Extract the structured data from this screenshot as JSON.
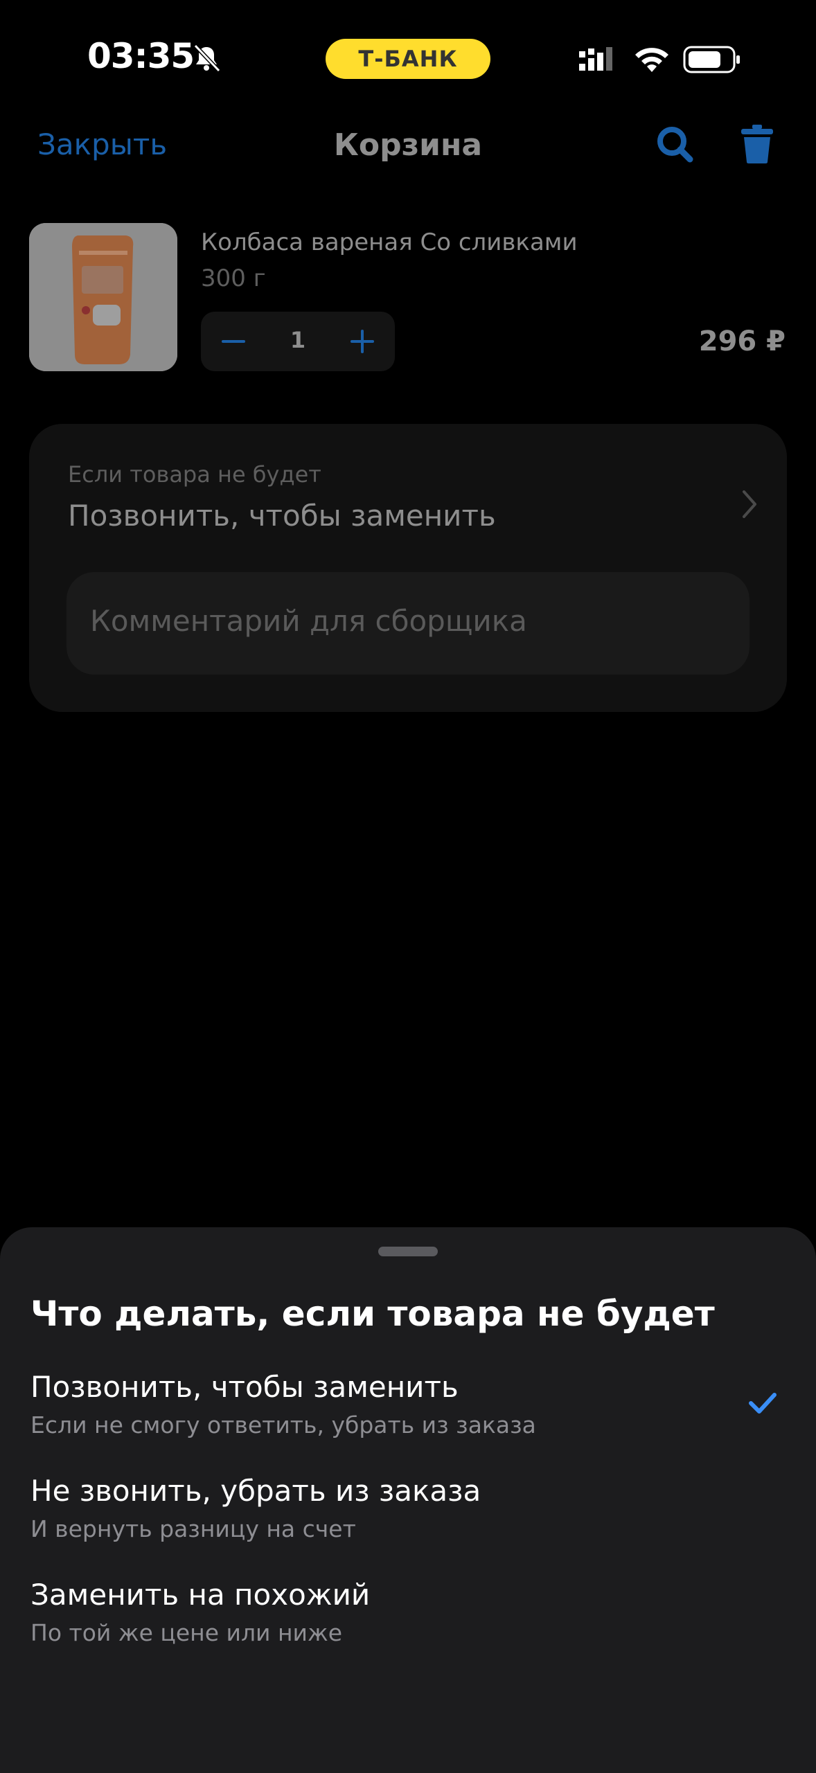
{
  "status_bar": {
    "time": "03:35",
    "bank_badge": "Т-БАНК"
  },
  "nav": {
    "close_label": "Закрыть",
    "title": "Корзина"
  },
  "product": {
    "name": "Колбаса вареная Со сливками",
    "weight": "300 г",
    "quantity": "1",
    "price": "296 ₽"
  },
  "replacement_card": {
    "caption": "Если товара не будет",
    "value": "Позвонить, чтобы заменить",
    "comment_placeholder": "Комментарий для сборщика"
  },
  "sheet": {
    "title": "Что делать, если товара не будет",
    "options": [
      {
        "title": "Позвонить, чтобы заменить",
        "subtitle": "Если не смогу ответить, убрать из заказа",
        "selected": true
      },
      {
        "title": "Не звонить, убрать из заказа",
        "subtitle": "И вернуть разницу на счет",
        "selected": false
      },
      {
        "title": "Заменить на похожий",
        "subtitle": "По той же цене или ниже",
        "selected": false
      }
    ]
  },
  "colors": {
    "accent": "#3A8EF6",
    "bank_yellow": "#FFDD2D",
    "sheet_bg": "#1C1C1E"
  }
}
